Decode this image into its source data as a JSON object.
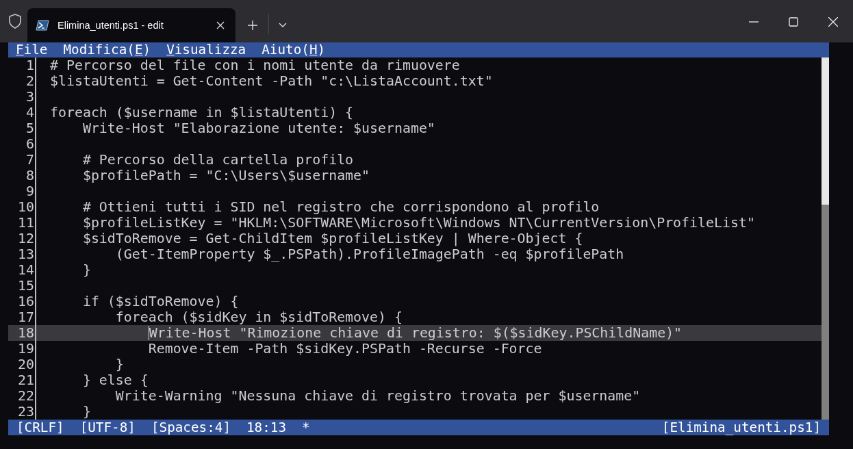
{
  "tab": {
    "title": "Elimina_utenti.ps1 - edit",
    "selected": true
  },
  "menu": [
    {
      "key": "F",
      "after": "ile"
    },
    {
      "before": "Modifica(",
      "key": "E",
      "after": ")"
    },
    {
      "key": "V",
      "after": "isualizza"
    },
    {
      "before": "Aiuto(",
      "key": "H",
      "after": ")"
    }
  ],
  "lines": [
    {
      "number": "1",
      "text": "# Percorso del file con i nomi utente da rimuovere",
      "current": false
    },
    {
      "number": "2",
      "text": "$listaUtenti = Get-Content -Path \"c:\\ListaAccount.txt\"",
      "current": false
    },
    {
      "number": "3",
      "current": false
    },
    {
      "number": "4",
      "text": "foreach ($username in $listaUtenti) {",
      "current": false
    },
    {
      "number": "5",
      "text": "    Write-Host \"Elaborazione utente: $username\"",
      "current": false
    },
    {
      "number": "6",
      "current": false
    },
    {
      "number": "7",
      "text": "    # Percorso della cartella profilo",
      "current": false
    },
    {
      "number": "8",
      "text": "    $profilePath = \"C:\\Users\\$username\"",
      "current": false
    },
    {
      "number": "9",
      "current": false
    },
    {
      "number": "10",
      "text": "    # Ottieni tutti i SID nel registro che corrispondono al profilo",
      "current": false
    },
    {
      "number": "11",
      "text": "    $profileListKey = \"HKLM:\\SOFTWARE\\Microsoft\\Windows NT\\CurrentVersion\\ProfileList\"",
      "current": false
    },
    {
      "number": "12",
      "text": "    $sidToRemove = Get-ChildItem $profileListKey | Where-Object {",
      "current": false
    },
    {
      "number": "13",
      "text": "        (Get-ItemProperty $_.PSPath).ProfileImagePath -eq $profilePath",
      "current": false
    },
    {
      "number": "14",
      "text": "    }",
      "current": false
    },
    {
      "number": "15",
      "current": false
    },
    {
      "number": "16",
      "text": "    if ($sidToRemove) {",
      "current": false
    },
    {
      "number": "17",
      "text": "        foreach ($sidKey in $sidToRemove) {",
      "current": false
    },
    {
      "number": "18",
      "text": "            Write-Host \"Rimozione chiave di registro: $($sidKey.PSChildName)\"",
      "current": true
    },
    {
      "number": "19",
      "text": "            Remove-Item -Path $sidKey.PSPath -Recurse -Force",
      "current": false
    },
    {
      "number": "20",
      "text": "        }",
      "current": false
    },
    {
      "number": "21",
      "text": "    } else {",
      "current": false
    },
    {
      "number": "22",
      "text": "        Write-Warning \"Nessuna chiave di registro trovata per $username\"",
      "current": false
    },
    {
      "number": "23",
      "text": "    }",
      "current": false
    }
  ],
  "status": {
    "line_ending": "[CRLF]",
    "encoding": "[UTF-8]",
    "indent": "[Spaces:4]",
    "position": "18:13",
    "modified": "*",
    "file": "[Elimina_utenti.ps1]"
  }
}
